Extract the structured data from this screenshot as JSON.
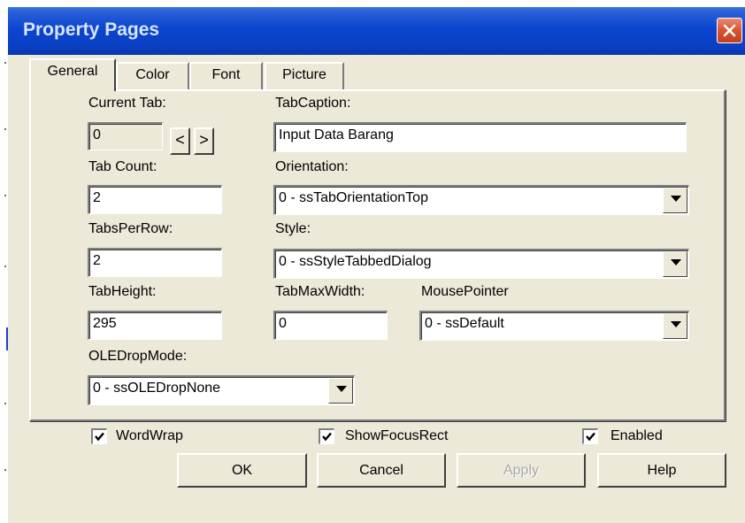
{
  "window": {
    "title": "Property Pages"
  },
  "tabs": [
    {
      "label": "General",
      "active": true
    },
    {
      "label": "Color"
    },
    {
      "label": "Font"
    },
    {
      "label": "Picture"
    }
  ],
  "general": {
    "current_tab_label": "Current Tab:",
    "current_tab_value": "0",
    "spin_prev": "<",
    "spin_next": ">",
    "tab_caption_label": "TabCaption:",
    "tab_caption_value": "Input Data Barang",
    "tab_count_label": "Tab Count:",
    "tab_count_value": "2",
    "orientation_label": "Orientation:",
    "orientation_value": "0 - ssTabOrientationTop",
    "tabs_per_row_label": "TabsPerRow:",
    "tabs_per_row_value": "2",
    "style_label": "Style:",
    "style_value": "0 - ssStyleTabbedDialog",
    "tab_height_label": "TabHeight:",
    "tab_height_value": "295",
    "tab_max_width_label": "TabMaxWidth:",
    "tab_max_width_value": "0",
    "mouse_pointer_label": "MousePointer",
    "mouse_pointer_value": "0 - ssDefault",
    "ole_drop_mode_label": "OLEDropMode:",
    "ole_drop_mode_value": "0 - ssOLEDropNone",
    "word_wrap_label": "WordWrap",
    "word_wrap_checked": true,
    "show_focus_rect_label": "ShowFocusRect",
    "show_focus_rect_checked": true,
    "enabled_label": "Enabled",
    "enabled_checked": true
  },
  "buttons": {
    "ok": "OK",
    "cancel": "Cancel",
    "apply": "Apply",
    "help": "Help"
  },
  "colors": {
    "titlebar": "#0a46cf",
    "dialog_bg": "#ece9d8",
    "close_red": "#d9532f"
  }
}
